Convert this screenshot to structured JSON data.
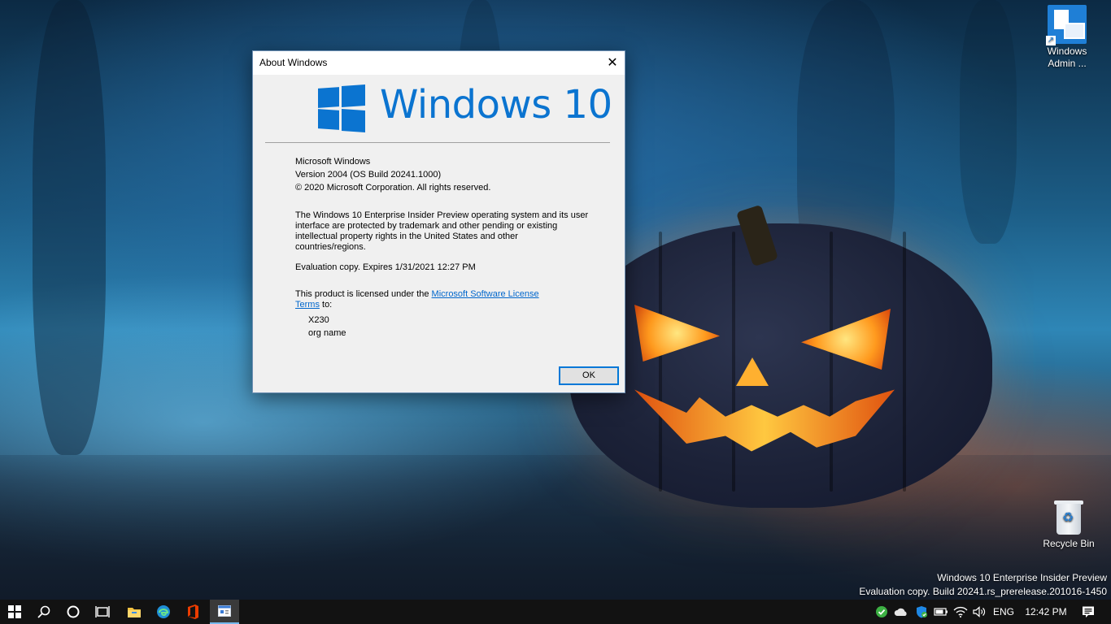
{
  "desktop": {
    "icons": [
      {
        "label": "Windows Admin ...",
        "icon": "windows-admin-center-icon"
      },
      {
        "label": "Recycle Bin",
        "icon": "recycle-bin-icon"
      }
    ],
    "watermark": {
      "line1": "Windows 10 Enterprise Insider Preview",
      "line2": "Evaluation copy. Build 20241.rs_prerelease.201016-1450"
    }
  },
  "dialog": {
    "title": "About Windows",
    "close_label": "✕",
    "logo_text": "Windows 10",
    "product": "Microsoft Windows",
    "version": "Version 2004 (OS Build 20241.1000)",
    "copyright": "© 2020 Microsoft Corporation. All rights reserved.",
    "legal": [
      "The Windows 10 Enterprise Insider Preview operating system and its user",
      "interface are protected by trademark and other pending or existing",
      "intellectual property rights in the United States and other",
      "countries/regions."
    ],
    "evaluation": "Evaluation copy. Expires 1/31/2021 12:27 PM",
    "license_prefix": "This product is licensed under the ",
    "license_link_1": "Microsoft Software License",
    "license_link_2": "Terms",
    "license_suffix": " to:",
    "licensee_user": "X230",
    "licensee_org": "org name",
    "ok_label": "OK"
  },
  "taskbar": {
    "items": [
      "start-icon",
      "search-icon",
      "cortana-icon",
      "task-view-icon",
      "file-explorer-icon",
      "edge-icon",
      "office-icon",
      "about-windows-app-icon"
    ],
    "tray": {
      "language": "ENG",
      "time": "12:42 PM"
    }
  },
  "colors": {
    "windows_blue": "#0b74d0",
    "link_blue": "#0066cc",
    "taskbar_bg": "#121212"
  }
}
